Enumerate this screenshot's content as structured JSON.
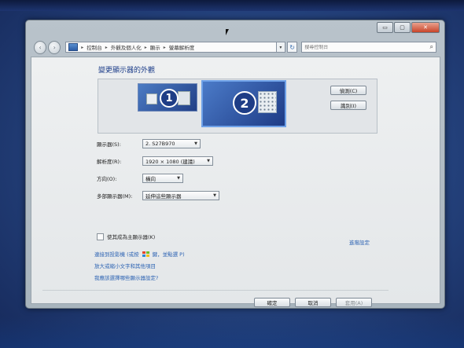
{
  "window": {
    "caption_buttons": {
      "minimize": "▭",
      "maximize": "▢",
      "close": "✕"
    }
  },
  "nav": {
    "back_icon": "‹",
    "forward_icon": "›",
    "breadcrumb": [
      "控制台",
      "外觀及個人化",
      "顯示",
      "螢幕解析度"
    ],
    "search_placeholder": "搜尋控制台",
    "refresh_icon": "↻",
    "search_icon": "⌕"
  },
  "main": {
    "heading": "變更顯示器的外觀",
    "monitors": [
      {
        "number": "1"
      },
      {
        "number": "2"
      }
    ],
    "detect_button": "偵測(C)",
    "identify_button": "識別(I)",
    "fields": {
      "display": {
        "label": "顯示器(S):",
        "value": "2. S27B970"
      },
      "resolution": {
        "label": "解析度(R):",
        "value": "1920 × 1080 (建議)"
      },
      "orientation": {
        "label": "方向(O):",
        "value": "橫向"
      },
      "multiple_displays": {
        "label": "多部顯示器(M):",
        "value": "延伸這些顯示器"
      }
    },
    "make_main_display": "使其成為主顯示器(K)",
    "advanced_settings": "進階設定",
    "links": {
      "projector_prefix": "連接到投影機 (或按",
      "projector_suffix": "鍵，並點選 P)",
      "text_size": "放大或縮小文字和其他項目",
      "which_settings": "我應該選擇哪些顯示器設定?"
    },
    "ok_button": "確定",
    "cancel_button": "取消",
    "apply_button": "套用(A)"
  },
  "colors": {
    "link": "#2d63b3",
    "heading": "#1f3f8a",
    "win_red": "#e3482a",
    "win_green": "#6cbe2c",
    "win_blue": "#2f87d8",
    "win_yellow": "#f3c21a"
  }
}
